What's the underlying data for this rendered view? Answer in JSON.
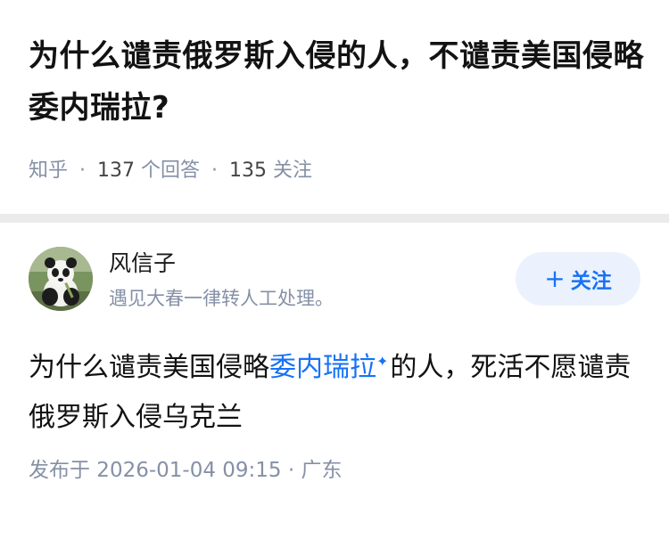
{
  "question": {
    "title": "为什么谴责俄罗斯入侵的人，不谴责美国侵略委内瑞拉?",
    "source": "知乎",
    "answer_count": "137",
    "answer_label": "个回答",
    "follower_count": "135",
    "follower_label": "关注",
    "separator": "·"
  },
  "answer": {
    "author": {
      "name": "风信子",
      "bio": "遇见大春一律转人工处理。"
    },
    "follow_button": {
      "plus": "+",
      "label": "关注"
    },
    "body": {
      "part1": "为什么谴责美国侵略",
      "link": "委内瑞拉",
      "part2": "的人，死活不愿谴责俄罗斯入侵乌克兰"
    },
    "meta": {
      "published": "发布于 2026-01-04 09:15",
      "separator": "·",
      "location": "广东"
    }
  },
  "colors": {
    "accent": "#1772f6",
    "muted": "#8590a6",
    "follow_bg": "#ebf2fd",
    "page_bg": "#ebebeb"
  },
  "icons": {
    "spark": "sparkle-icon"
  }
}
